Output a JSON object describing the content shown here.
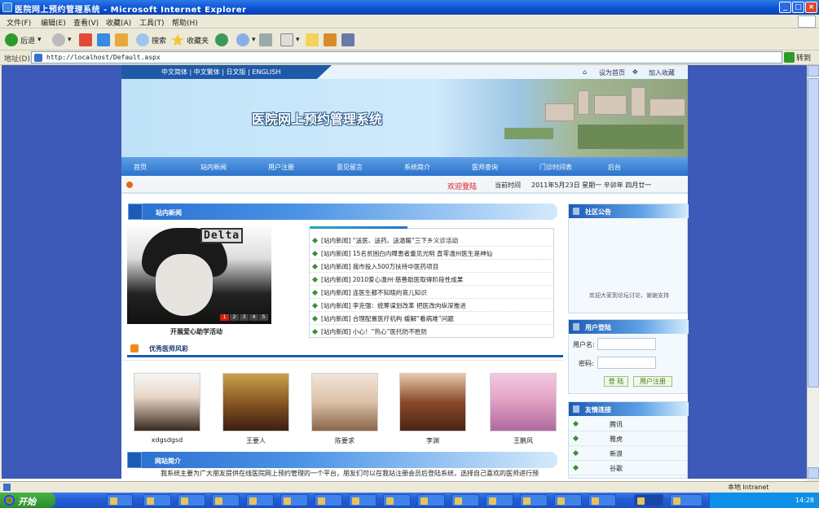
{
  "window": {
    "title": "医院网上预约管理系统 - Microsoft Internet Explorer"
  },
  "menu": [
    "文件(F)",
    "编辑(E)",
    "查看(V)",
    "收藏(A)",
    "工具(T)",
    "帮助(H)"
  ],
  "toolbar": {
    "back": "后退",
    "search": "搜索",
    "favorites": "收藏夹"
  },
  "address": {
    "label": "地址(D)",
    "url": "http://localhost/Default.aspx",
    "go": "转到"
  },
  "site": {
    "languages": "中文简体 | 中文繁体 | 日文版 | ENGLISH",
    "set_home": "设为首页",
    "add_favorite": "加入收藏",
    "name": "医院网上预约管理系统",
    "nav": [
      "首页",
      "站内新闻",
      "用户注册",
      "意见留言",
      "系统简介",
      "医师查询",
      "门诊时间表",
      "后台"
    ],
    "welcome_login": "欢迎登陆",
    "current_time_label": "当前时间",
    "current_time": "2011年5月23日 星期一 辛卯年 四月廿一"
  },
  "news": {
    "title": "站内新闻",
    "slide_text": "Delta",
    "slide_pages": [
      "1",
      "2",
      "3",
      "4",
      "5"
    ],
    "slide_caption": "开展爱心助学活动",
    "items": [
      "[站内新闻] “送医、送药、送温暖”三下乡义诊活动",
      "[站内新闻] 15名贫困白内障患者重见光明 直零温州医生是神仙",
      "[站内新闻] 我市投入500万扶持中医药项目",
      "[站内新闻] 2010爱心温州·慈善助医取得阶段性成果",
      "[站内新闻] 连医生都不知晓的育儿知识",
      "[站内新闻] 李克强：统筹谋划改革 把医改向纵深推进",
      "[站内新闻] 合理配置医疗机构 缓解“看病难”问题",
      "[站内新闻] 小心！“热心”医托防不胜防"
    ]
  },
  "doctors": {
    "title": "优秀医师风彩",
    "list": [
      "xdgsdgsd",
      "王要人",
      "陈要求",
      "李渊",
      "王鹏风"
    ]
  },
  "intro": {
    "title": "网站简介",
    "text": "我系统主要为广大朋友提供在线医院网上预约管理的一个平台，朋友们可以在我站注册会员后登陆系统，选择自己喜欢的医师进行预"
  },
  "notice": {
    "title": "社区公告",
    "text": "欢迎大家到论坛讨论，谢谢支持"
  },
  "login": {
    "title": "用户登陆",
    "username_label": "用户名:",
    "password_label": "密码:",
    "login_btn": "登 陆",
    "register_btn": "用户注册"
  },
  "links": {
    "title": "友情连接",
    "items": [
      "腾讯",
      "雅虎",
      "新浪",
      "谷歌"
    ]
  },
  "status": {
    "zone": "本地 Intranet"
  },
  "taskbar": {
    "start": "开始",
    "clock": "14:28"
  }
}
